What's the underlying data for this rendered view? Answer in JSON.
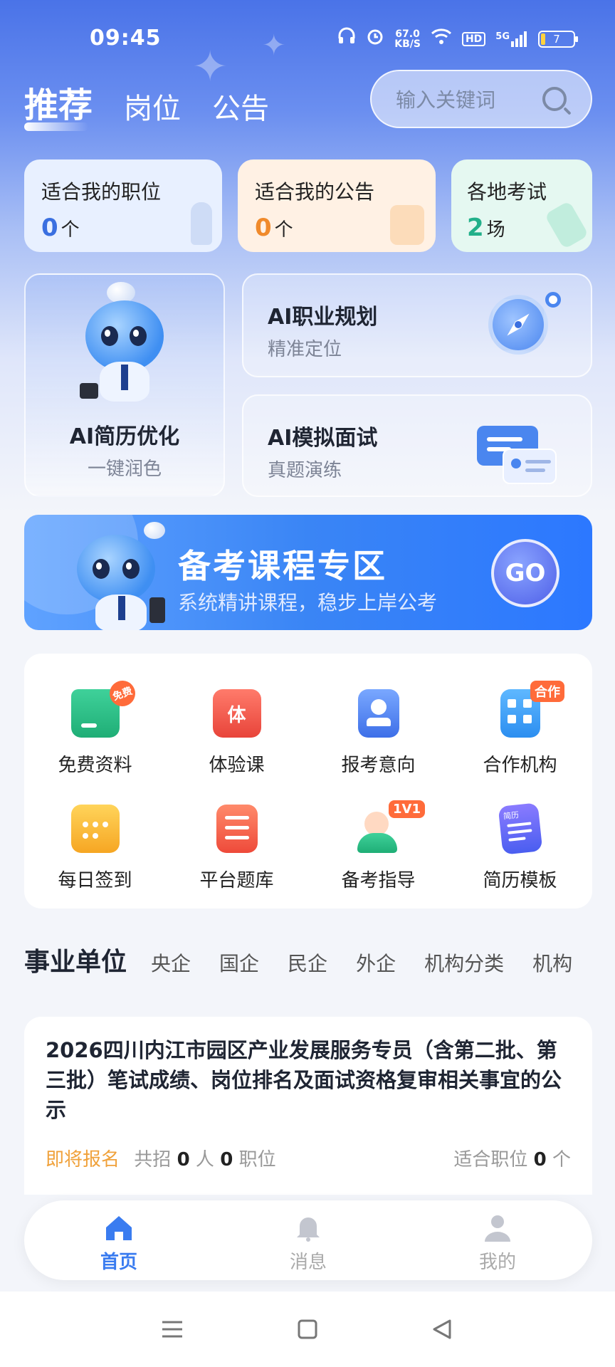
{
  "status_bar": {
    "time": "09:45",
    "speed_value": "67.0",
    "speed_unit": "KB/S",
    "hd": "HD",
    "network": "5G",
    "battery": "7"
  },
  "header": {
    "tabs": [
      {
        "label": "推荐",
        "active": true
      },
      {
        "label": "岗位",
        "active": false
      },
      {
        "label": "公告",
        "active": false
      }
    ],
    "search_placeholder": "输入关键词"
  },
  "stat_cards": [
    {
      "title": "适合我的职位",
      "value": "0",
      "unit": "个",
      "color": "#3a6fe0",
      "bg": "#e6efff"
    },
    {
      "title": "适合我的公告",
      "value": "0",
      "unit": "个",
      "color": "#f08a2b",
      "bg": "#fff0e2"
    },
    {
      "title": "各地考试",
      "value": "2",
      "unit": "场",
      "color": "#22b08a",
      "bg": "#e4f8f1"
    }
  ],
  "ai_cards": {
    "resume": {
      "title": "AI简历优化",
      "subtitle": "一键润色"
    },
    "career": {
      "title": "AI职业规划",
      "subtitle": "精准定位"
    },
    "interview": {
      "title": "AI模拟面试",
      "subtitle": "真题演练"
    }
  },
  "banner": {
    "title": "备考课程专区",
    "subtitle": "系统精讲课程，稳步上岸公考",
    "button": "GO"
  },
  "quick_grid": [
    {
      "label": "免费资料",
      "icon": "folder-icon",
      "tag": "免费"
    },
    {
      "label": "体验课",
      "icon": "book-icon",
      "tag": "体"
    },
    {
      "label": "报考意向",
      "icon": "id-card-icon",
      "tag": ""
    },
    {
      "label": "合作机构",
      "icon": "building-icon",
      "tag": "合作"
    },
    {
      "label": "每日签到",
      "icon": "calendar-icon",
      "tag": ""
    },
    {
      "label": "平台题库",
      "icon": "question-bank-icon",
      "tag": ""
    },
    {
      "label": "备考指导",
      "icon": "tutor-icon",
      "tag": "1V1"
    },
    {
      "label": "简历模板",
      "icon": "document-icon",
      "tag": "简历"
    }
  ],
  "categories": [
    "事业单位",
    "央企",
    "国企",
    "民企",
    "外企",
    "机构分类",
    "机构"
  ],
  "listing": {
    "title": "2026四川内江市园区产业发展服务专员（含第二批、第三批）笔试成绩、岗位排名及面试资格复审相关事宜的公示",
    "status": "即将报名",
    "recruit_prefix": "共招",
    "people_count": "0",
    "people_unit": "人",
    "position_count": "0",
    "position_unit": "职位",
    "match_label": "适合职位",
    "match_count": "0",
    "match_unit": "个"
  },
  "bottom_nav": [
    {
      "label": "首页",
      "icon": "home-icon",
      "active": true
    },
    {
      "label": "消息",
      "icon": "bell-icon",
      "active": false
    },
    {
      "label": "我的",
      "icon": "user-icon",
      "active": false
    }
  ]
}
